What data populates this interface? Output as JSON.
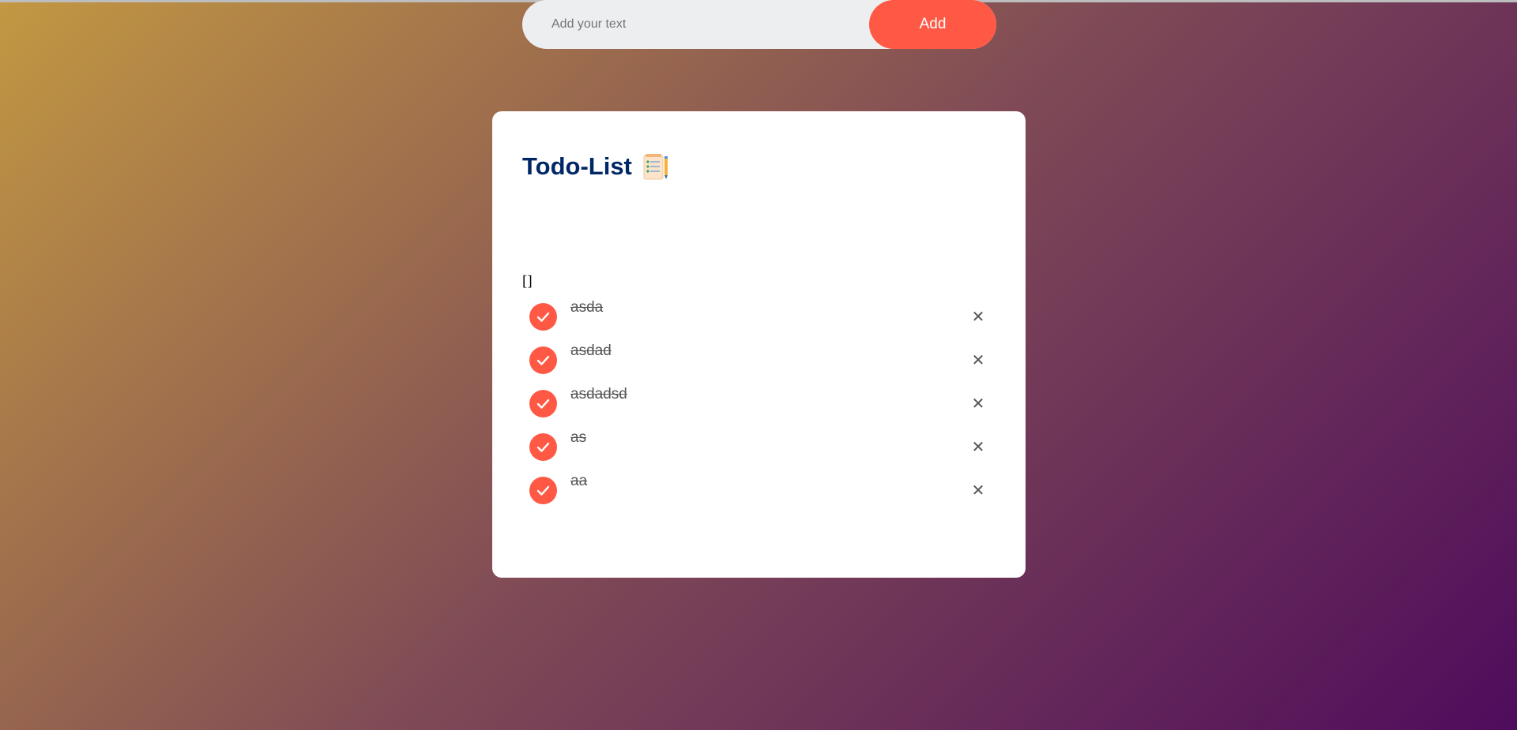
{
  "app": {
    "title": "Todo-List",
    "title_icon": "notepad-checklist-icon"
  },
  "input": {
    "placeholder": "Add your text",
    "value": ""
  },
  "add_button": {
    "label": "Add"
  },
  "debug_output": "[]",
  "todos": [
    {
      "text": "asda",
      "checked": true
    },
    {
      "text": "asdad",
      "checked": true
    },
    {
      "text": "asdadsd",
      "checked": true
    },
    {
      "text": "as",
      "checked": true
    },
    {
      "text": "aa",
      "checked": true
    }
  ],
  "close_glyph": "✕",
  "colors": {
    "accent": "#ff5945",
    "title": "#002765",
    "input_bg": "#edeef0",
    "card_bg": "#ffffff",
    "gradient_start": "#c29842",
    "gradient_end": "#4f0c5c"
  }
}
